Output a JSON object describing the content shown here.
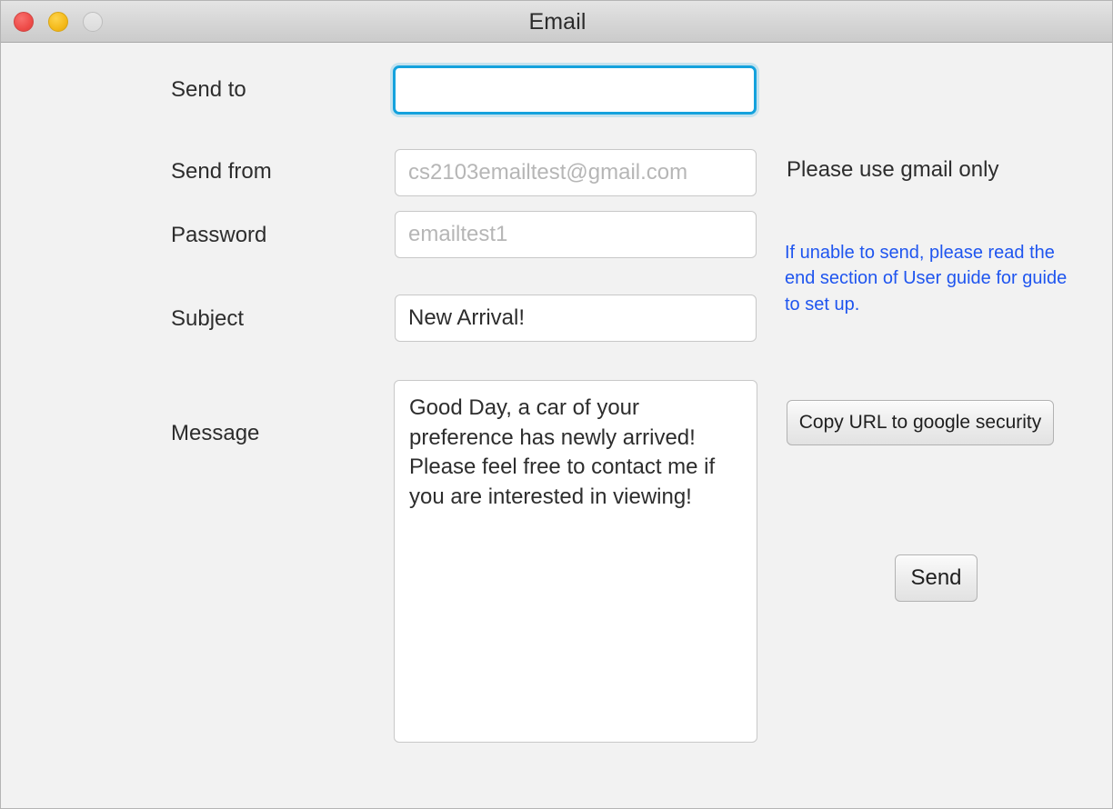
{
  "window": {
    "title": "Email",
    "controls": {
      "close": "close-button",
      "minimize": "minimize-button",
      "zoom": "zoom-button"
    }
  },
  "form": {
    "send_to": {
      "label": "Send to",
      "value": "",
      "placeholder": "",
      "focused": true
    },
    "send_from": {
      "label": "Send from",
      "value": "",
      "placeholder": "cs2103emailtest@gmail.com"
    },
    "password": {
      "label": "Password",
      "value": "",
      "placeholder": "emailtest1"
    },
    "subject": {
      "label": "Subject",
      "value": "New Arrival!",
      "placeholder": ""
    },
    "message": {
      "label": "Message",
      "value": "Good Day, a car of your preference has newly arrived! Please feel free to contact me if you are interested in viewing!",
      "placeholder": ""
    }
  },
  "sidebar": {
    "gmail_note": "Please use gmail only",
    "trouble_hint": "If unable to send, please read the end section of User guide for guide to set up.",
    "copy_url_button": "Copy URL to google security",
    "send_button": "Send"
  },
  "colors": {
    "focus_border": "#14a2dd",
    "hint_text": "#1f55ef",
    "close": "#ee4b48",
    "minimize": "#f4b919",
    "zoom": "#dcdcdc",
    "background": "#f2f2f2"
  }
}
